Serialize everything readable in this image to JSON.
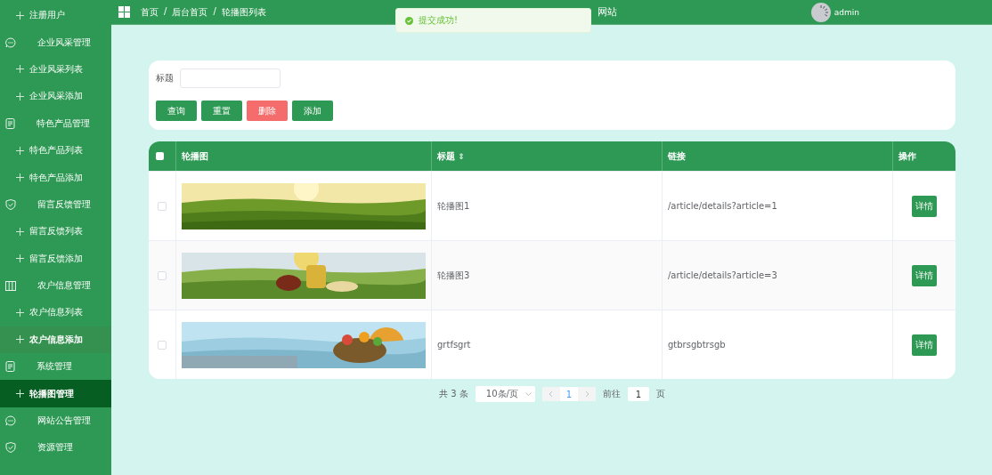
{
  "sidebar": {
    "items": [
      {
        "kind": "child",
        "label": "注册用户",
        "selected": false
      },
      {
        "kind": "group",
        "label": "企业风采管理",
        "selected": false
      },
      {
        "kind": "child",
        "label": "企业风采列表",
        "selected": false
      },
      {
        "kind": "child",
        "label": "企业风采添加",
        "selected": false
      },
      {
        "kind": "group",
        "label": "特色产品管理",
        "selected": false
      },
      {
        "kind": "child",
        "label": "特色产品列表",
        "selected": false
      },
      {
        "kind": "child",
        "label": "特色产品添加",
        "selected": false
      },
      {
        "kind": "group",
        "label": "留言反馈管理",
        "selected": false
      },
      {
        "kind": "child",
        "label": "留言反馈列表",
        "selected": false
      },
      {
        "kind": "child",
        "label": "留言反馈添加",
        "selected": false
      },
      {
        "kind": "group",
        "label": "农户信息管理",
        "selected": false
      },
      {
        "kind": "child",
        "label": "农户信息列表",
        "selected": false
      },
      {
        "kind": "child",
        "label": "农户信息添加",
        "selected": false,
        "hovered": true
      },
      {
        "kind": "group",
        "label": "系统管理",
        "selected": false
      },
      {
        "kind": "child",
        "label": "轮播图管理",
        "selected": true
      },
      {
        "kind": "group",
        "label": "网站公告管理",
        "selected": false
      },
      {
        "kind": "group",
        "label": "资源管理",
        "selected": false
      }
    ]
  },
  "header": {
    "breadcrumb": [
      "首页",
      "后台首页",
      "轮播图列表"
    ],
    "separator": "/",
    "site_title": "网站",
    "user": "admin"
  },
  "toast": {
    "message": "提交成功!"
  },
  "search": {
    "label": "标题",
    "buttons": [
      {
        "label": "查询",
        "kind": "primary"
      },
      {
        "label": "重置",
        "kind": "primary"
      },
      {
        "label": "删除",
        "kind": "danger"
      },
      {
        "label": "添加",
        "kind": "primary"
      }
    ]
  },
  "table": {
    "columns": [
      "轮播图",
      "标题",
      "链接",
      "操作"
    ],
    "sort_icon": "⇕",
    "all_checked": false,
    "rows": [
      {
        "checked": false,
        "title": "轮播图1",
        "link": "/article/details?article=1",
        "action": "详情"
      },
      {
        "checked": false,
        "title": "轮播图3",
        "link": "/article/details?article=3",
        "action": "详情"
      },
      {
        "checked": false,
        "title": "grtfsgrt",
        "link": "gtbrsgbtrsgb",
        "action": "详情"
      }
    ]
  },
  "pagination": {
    "total": "共 3 条",
    "page_size": "10条/页",
    "pages": [
      {
        "label": "1",
        "selected": true
      }
    ],
    "goto_label": "前往",
    "goto_value": "1",
    "goto_suffix": "页"
  }
}
